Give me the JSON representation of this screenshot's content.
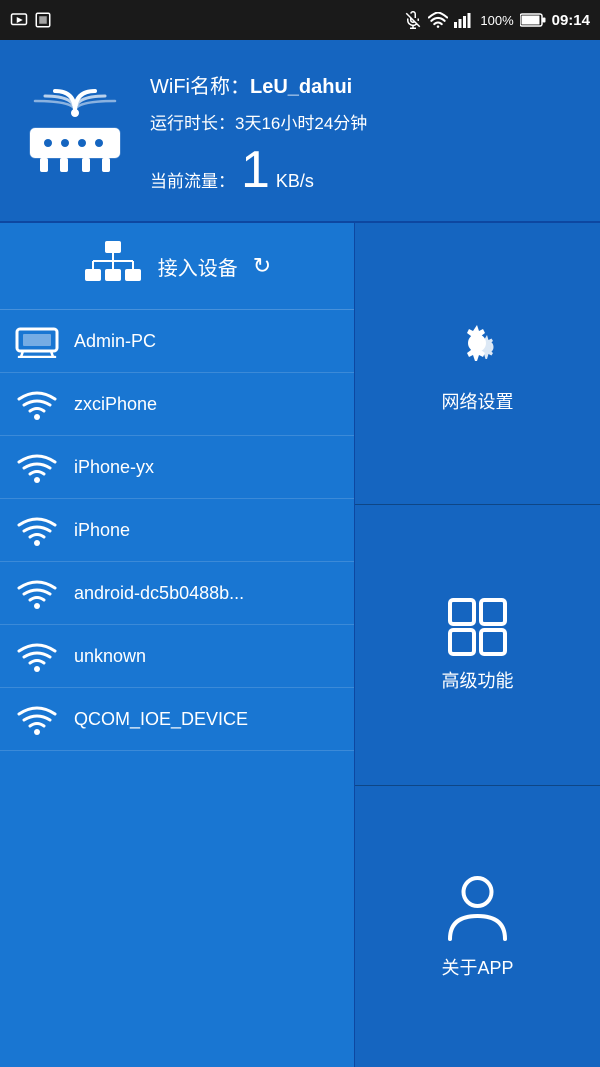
{
  "statusBar": {
    "time": "09:14",
    "battery": "100%",
    "icons": [
      "screen-record",
      "screenshot",
      "mute",
      "wifi",
      "signal",
      "battery"
    ]
  },
  "wifiPanel": {
    "wifiLabel": "WiFi名称：",
    "wifiName": "LeU_dahui",
    "uptimeLabel": "运行时长：",
    "uptime": "3天16小时24分钟",
    "trafficLabel": "当前流量：",
    "trafficValue": "1",
    "trafficUnit": "KB/s"
  },
  "devicesPanel": {
    "headerText": "接入设备",
    "devices": [
      {
        "name": "Admin-PC",
        "type": "wired"
      },
      {
        "name": "zxciPhone",
        "type": "wifi"
      },
      {
        "name": "iPhone-yx",
        "type": "wifi"
      },
      {
        "name": "iPhone",
        "type": "wifi"
      },
      {
        "name": "android-dc5b0488b...",
        "type": "wifi"
      },
      {
        "name": "unknown",
        "type": "wifi"
      },
      {
        "name": "QCOM_IOE_DEVICE",
        "type": "wifi"
      }
    ]
  },
  "actionsPanel": {
    "buttons": [
      {
        "id": "network-settings",
        "label": "网络设置"
      },
      {
        "id": "advanced-features",
        "label": "高级功能"
      },
      {
        "id": "about-app",
        "label": "关于APP"
      }
    ]
  }
}
